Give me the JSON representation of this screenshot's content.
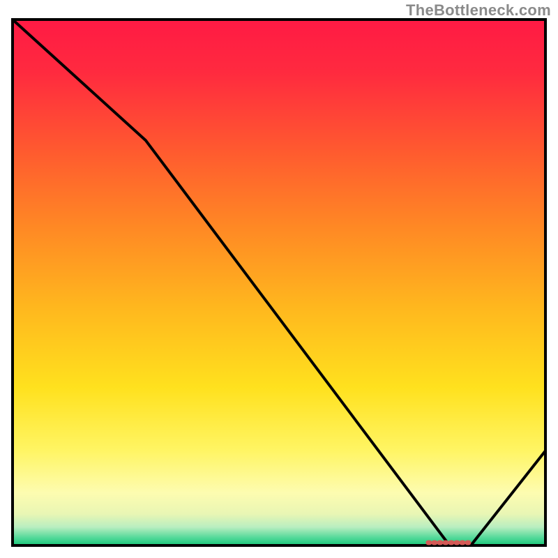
{
  "watermark": "TheBottleneck.com",
  "chart_data": {
    "type": "line",
    "x": [
      0,
      25,
      82,
      86,
      100
    ],
    "y": [
      100,
      77,
      0,
      0,
      18
    ],
    "xlim": [
      0,
      100
    ],
    "ylim": [
      0,
      100
    ],
    "title": "",
    "xlabel": "",
    "ylabel": "",
    "marker_region": {
      "x_start": 78,
      "x_end": 86,
      "y": 0
    },
    "background": {
      "type": "vertical-gradient",
      "stops": [
        {
          "pos": 0.0,
          "color": "#ff1a44"
        },
        {
          "pos": 0.1,
          "color": "#ff2a3f"
        },
        {
          "pos": 0.25,
          "color": "#ff5a2f"
        },
        {
          "pos": 0.4,
          "color": "#ff8a24"
        },
        {
          "pos": 0.55,
          "color": "#ffb81e"
        },
        {
          "pos": 0.7,
          "color": "#ffe11e"
        },
        {
          "pos": 0.82,
          "color": "#fff564"
        },
        {
          "pos": 0.9,
          "color": "#fdfcb0"
        },
        {
          "pos": 0.94,
          "color": "#e9f6b4"
        },
        {
          "pos": 0.965,
          "color": "#b9eec0"
        },
        {
          "pos": 0.985,
          "color": "#55d99a"
        },
        {
          "pos": 1.0,
          "color": "#18c879"
        }
      ]
    },
    "line_color": "#000000",
    "marker_color": "#d45a56"
  }
}
